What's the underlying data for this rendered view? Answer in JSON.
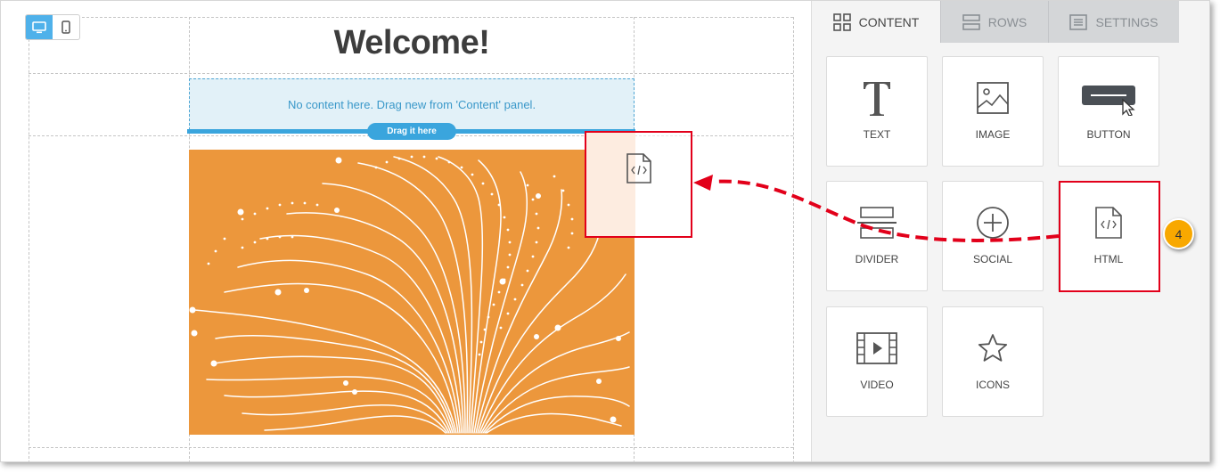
{
  "canvas": {
    "heading": "Welcome!",
    "dropzone_text": "No content here. Drag new from 'Content' panel.",
    "drag_pill": "Drag it here"
  },
  "device_toggle": {
    "desktop_icon": "desktop-icon",
    "mobile_icon": "mobile-icon",
    "active": "desktop"
  },
  "panel": {
    "tabs": [
      {
        "label": "CONTENT",
        "icon": "grid-icon",
        "active": true
      },
      {
        "label": "ROWS",
        "icon": "rows-icon",
        "active": false
      },
      {
        "label": "SETTINGS",
        "icon": "settings-list-icon",
        "active": false
      }
    ],
    "blocks": [
      {
        "label": "TEXT",
        "icon": "text-icon"
      },
      {
        "label": "IMAGE",
        "icon": "image-icon"
      },
      {
        "label": "BUTTON",
        "icon": "button-icon"
      },
      {
        "label": "DIVIDER",
        "icon": "divider-icon"
      },
      {
        "label": "SOCIAL",
        "icon": "social-icon"
      },
      {
        "label": "HTML",
        "icon": "html-icon"
      },
      {
        "label": "VIDEO",
        "icon": "video-icon"
      },
      {
        "label": "ICONS",
        "icon": "star-icon"
      }
    ]
  },
  "annotation": {
    "step_number": "4",
    "highlight_color": "#e2001a",
    "badge_color": "#f8a800"
  },
  "colors": {
    "accent": "#3aa5dd",
    "hero_bg": "#ec973c",
    "dropzone_bg": "#e2f1f8"
  }
}
